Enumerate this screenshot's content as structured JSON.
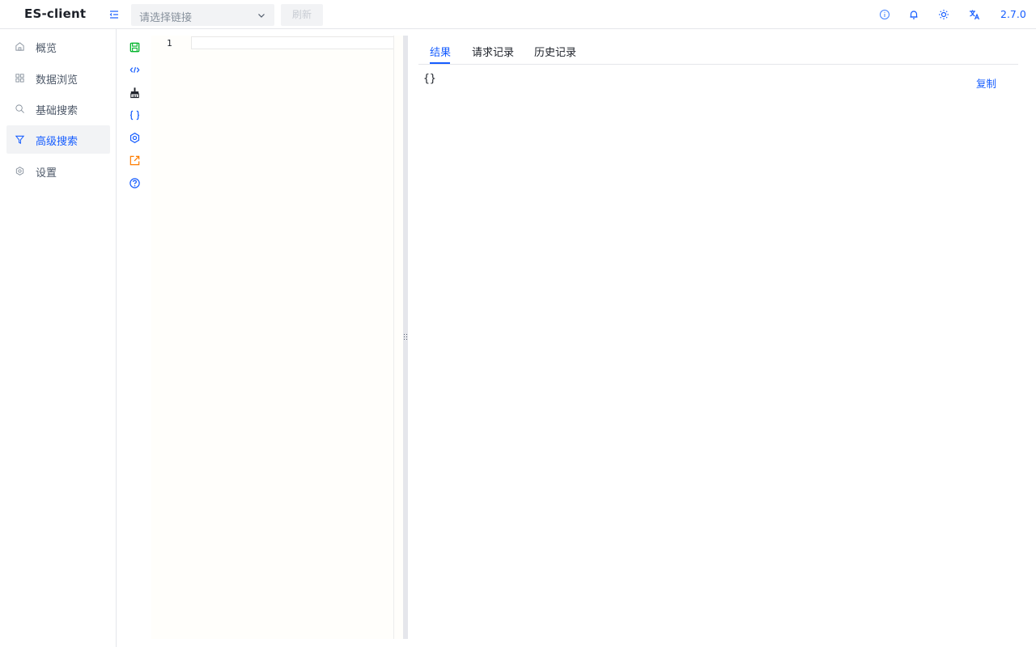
{
  "header": {
    "app_title": "ES-client",
    "connection_placeholder": "请选择链接",
    "refresh_label": "刷新",
    "version": "2.7.0"
  },
  "sidebar": {
    "items": [
      {
        "label": "概览",
        "icon": "home-icon",
        "active": false
      },
      {
        "label": "数据浏览",
        "icon": "grid-icon",
        "active": false
      },
      {
        "label": "基础搜索",
        "icon": "search-icon",
        "active": false
      },
      {
        "label": "高级搜索",
        "icon": "filter-icon",
        "active": true
      },
      {
        "label": "设置",
        "icon": "gear-icon",
        "active": false
      }
    ]
  },
  "toolbar": {
    "tools": [
      {
        "icon": "save-icon",
        "color": "#00b42a"
      },
      {
        "icon": "code-icon",
        "color": "#165dff"
      },
      {
        "icon": "clear-brush-icon",
        "color": "#1d2129"
      },
      {
        "icon": "format-braces-icon",
        "color": "#165dff"
      },
      {
        "icon": "settings-icon",
        "color": "#165dff"
      },
      {
        "icon": "export-icon",
        "color": "#ff7d00"
      },
      {
        "icon": "help-icon",
        "color": "#165dff"
      }
    ]
  },
  "editor": {
    "line_number": "1",
    "content": ""
  },
  "results": {
    "tabs": [
      {
        "label": "结果",
        "active": true
      },
      {
        "label": "请求记录",
        "active": false
      },
      {
        "label": "历史记录",
        "active": false
      }
    ],
    "output": "{}",
    "copy_label": "复制"
  },
  "colors": {
    "accent": "#165dff",
    "success": "#00b42a",
    "warning": "#ff7d00"
  }
}
